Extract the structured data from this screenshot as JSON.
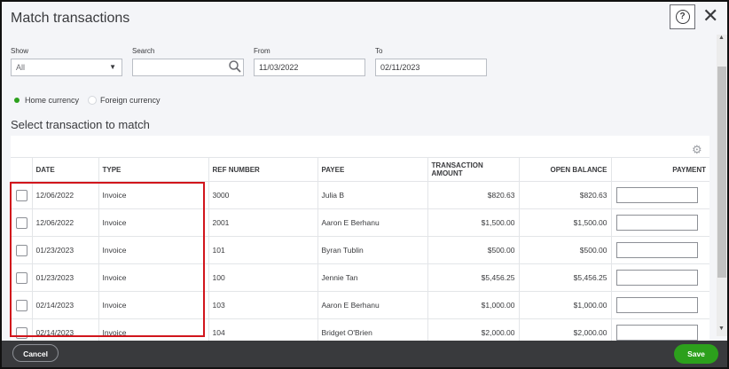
{
  "dialog": {
    "title": "Match transactions",
    "help_label": "?",
    "close_label": "✕"
  },
  "filters": {
    "show_label": "Show",
    "show_value": "All",
    "search_label": "Search",
    "search_value": "",
    "from_label": "From",
    "from_value": "11/03/2022",
    "to_label": "To",
    "to_value": "02/11/2023"
  },
  "currency": {
    "home_label": "Home currency",
    "foreign_label": "Foreign currency",
    "selected": "Home currency"
  },
  "section_heading": "Select transaction to match",
  "table": {
    "columns": [
      "DATE",
      "TYPE",
      "REF NUMBER",
      "PAYEE",
      "TRANSACTION AMOUNT",
      "OPEN BALANCE",
      "PAYMENT"
    ],
    "rows": [
      {
        "date": "12/06/2022",
        "type": "Invoice",
        "ref": "3000",
        "payee": "Julia B",
        "amount": "$820.63",
        "balance": "$820.63",
        "payment": ""
      },
      {
        "date": "12/06/2022",
        "type": "Invoice",
        "ref": "2001",
        "payee": "Aaron E Berhanu",
        "amount": "$1,500.00",
        "balance": "$1,500.00",
        "payment": ""
      },
      {
        "date": "01/23/2023",
        "type": "Invoice",
        "ref": "101",
        "payee": "Byran Tublin",
        "amount": "$500.00",
        "balance": "$500.00",
        "payment": ""
      },
      {
        "date": "01/23/2023",
        "type": "Invoice",
        "ref": "100",
        "payee": "Jennie Tan",
        "amount": "$5,456.25",
        "balance": "$5,456.25",
        "payment": ""
      },
      {
        "date": "02/14/2023",
        "type": "Invoice",
        "ref": "103",
        "payee": "Aaron E Berhanu",
        "amount": "$1,000.00",
        "balance": "$1,000.00",
        "payment": ""
      },
      {
        "date": "02/14/2023",
        "type": "Invoice",
        "ref": "104",
        "payee": "Bridget O'Brien",
        "amount": "$2,000.00",
        "balance": "$2,000.00",
        "payment": ""
      }
    ]
  },
  "footer": {
    "cancel_label": "Cancel",
    "save_label": "Save"
  },
  "colors": {
    "accent_green": "#2ca01c",
    "highlight_red": "#d1151c",
    "footer_bg": "#393a3d"
  }
}
